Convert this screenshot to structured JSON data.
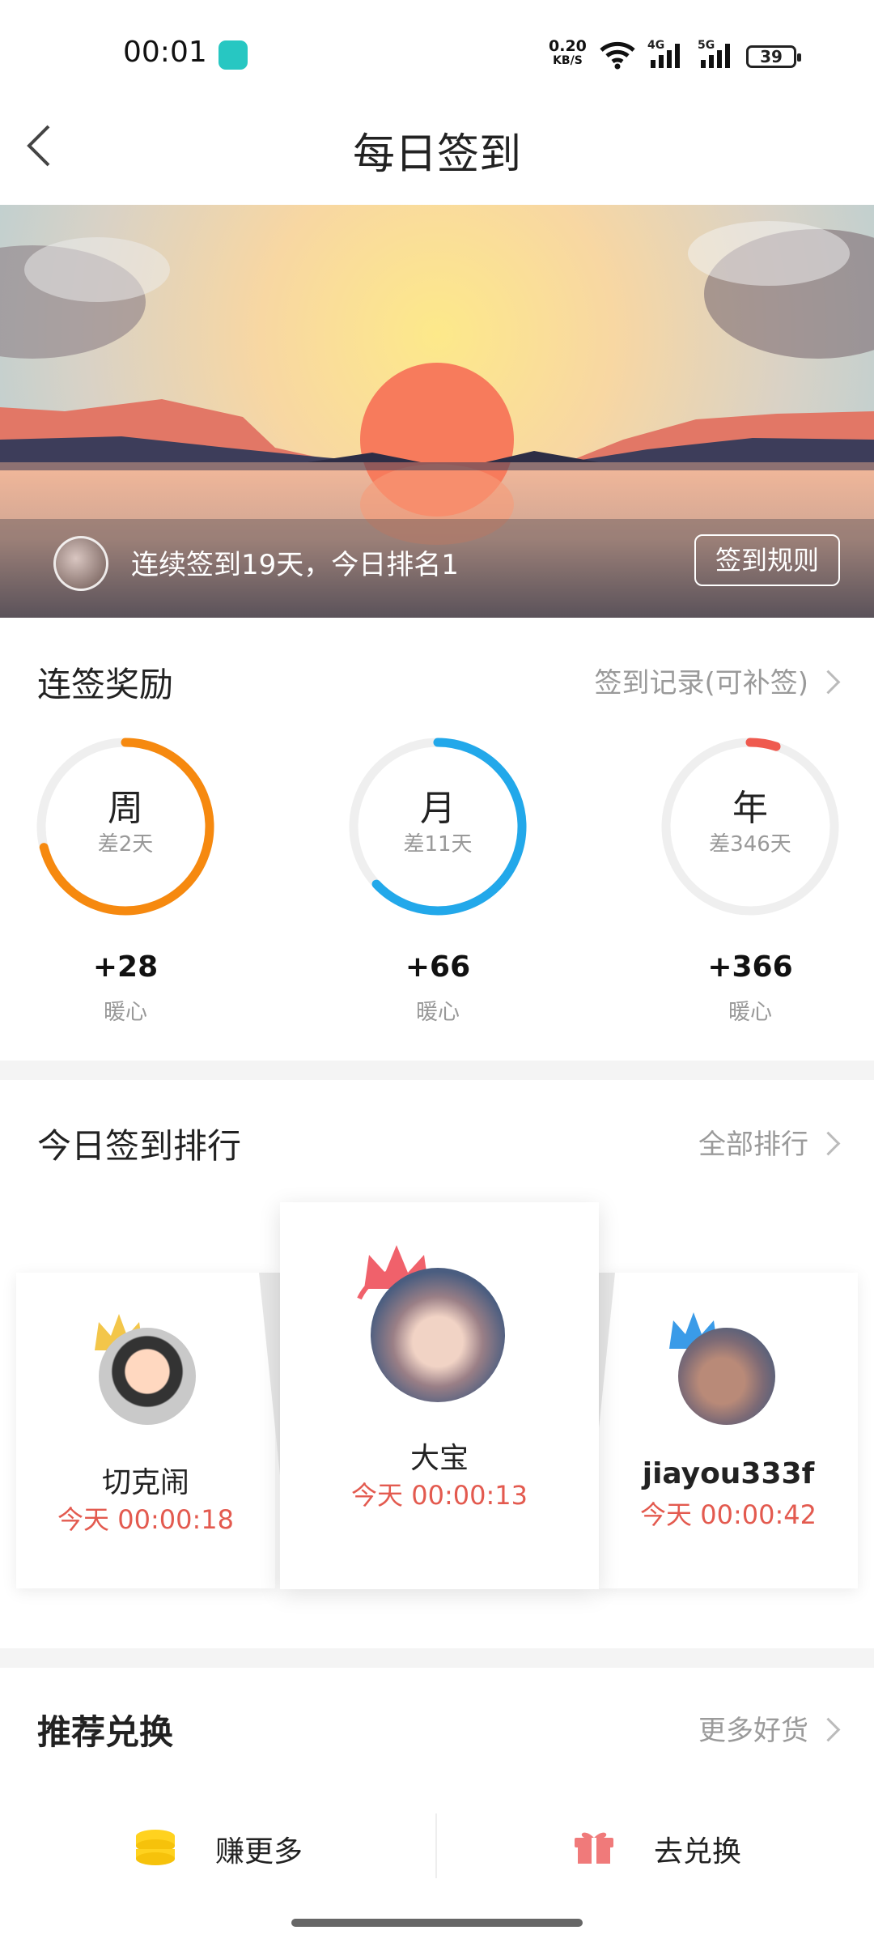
{
  "status_bar": {
    "time": "00:01",
    "net_speed_value": "0.20",
    "net_speed_unit": "KB/S",
    "sig1": "4G",
    "sig2": "5G",
    "battery": "39"
  },
  "header": {
    "title": "每日签到"
  },
  "hero": {
    "streak_text": "连续签到19天，今日排名1",
    "rules_button": "签到规则"
  },
  "streak_rewards": {
    "title": "连签奖励",
    "record_link": "签到记录(可补签)",
    "items": [
      {
        "label": "周",
        "remaining": "差2天",
        "reward": "+28",
        "unit": "暖心",
        "progress": 0.71,
        "color": "#f6890f"
      },
      {
        "label": "月",
        "remaining": "差11天",
        "reward": "+66",
        "unit": "暖心",
        "progress": 0.63,
        "color": "#22a8ea"
      },
      {
        "label": "年",
        "remaining": "差346天",
        "reward": "+366",
        "unit": "暖心",
        "progress": 0.05,
        "color": "#ef5a4f"
      }
    ]
  },
  "ranking": {
    "title": "今日签到排行",
    "all_link": "全部排行",
    "entries": [
      {
        "rank": 2,
        "name": "切克闹",
        "time": "今天 00:00:18"
      },
      {
        "rank": 1,
        "name": "大宝",
        "time": "今天 00:00:13"
      },
      {
        "rank": 3,
        "name": "jiayou333f",
        "time": "今天 00:00:42"
      }
    ]
  },
  "recommend": {
    "title": "推荐兑换",
    "more_link": "更多好货"
  },
  "bottom_bar": {
    "earn_label": "赚更多",
    "exchange_label": "去兑换"
  }
}
